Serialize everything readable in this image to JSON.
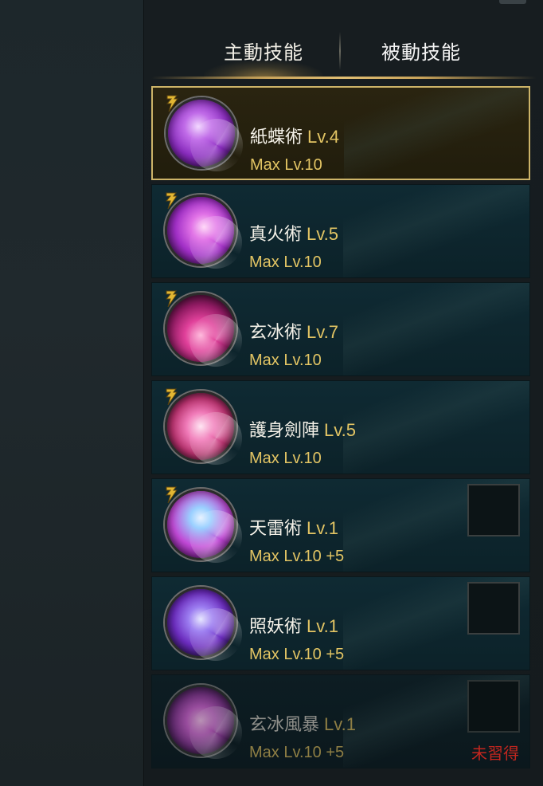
{
  "tabs": {
    "active": "主動技能",
    "passive": "被動技能"
  },
  "skills": [
    {
      "name": "紙蝶術",
      "level": "Lv.4",
      "max": "Max Lv.10",
      "selected": true,
      "has_badge": true,
      "has_slot": false
    },
    {
      "name": "真火術",
      "level": "Lv.5",
      "max": "Max Lv.10",
      "selected": false,
      "has_badge": true,
      "has_slot": false
    },
    {
      "name": "玄冰術",
      "level": "Lv.7",
      "max": "Max Lv.10",
      "selected": false,
      "has_badge": true,
      "has_slot": false
    },
    {
      "name": "護身劍陣",
      "level": "Lv.5",
      "max": "Max Lv.10",
      "selected": false,
      "has_badge": true,
      "has_slot": false
    },
    {
      "name": "天雷術",
      "level": "Lv.1",
      "max": "Max Lv.10 +5",
      "selected": false,
      "has_badge": true,
      "has_slot": true
    },
    {
      "name": "照妖術",
      "level": "Lv.1",
      "max": "Max Lv.10 +5",
      "selected": false,
      "has_badge": false,
      "has_slot": true
    },
    {
      "name": "玄冰風暴",
      "level": "Lv.1",
      "max": "Max Lv.10 +5",
      "selected": false,
      "has_badge": false,
      "has_slot": true,
      "status": "未習得"
    }
  ],
  "colors": {
    "accent_gold": "#e3c564",
    "selected_border": "#cdb468",
    "unlearned_red": "#c3261f",
    "row_bg": "#0f2a33"
  },
  "icons": {
    "badge": "lightning-badge-icon"
  }
}
